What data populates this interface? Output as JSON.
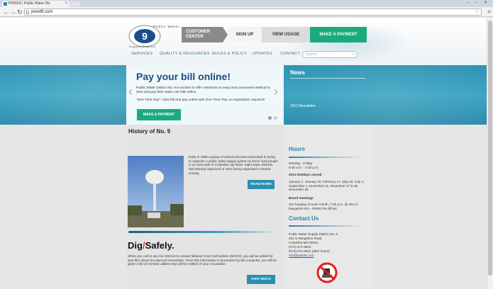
{
  "browser": {
    "tab_title": "PWSD9 | Public Water Dis",
    "tab_close": "×",
    "url": "pwsd9.com"
  },
  "header": {
    "logo": {
      "top_text": "Public Water",
      "number": "9",
      "bottom_text": "Supply District"
    },
    "customer_center": "CUSTOMER CENTER",
    "sign_up": "SIGN UP",
    "view_usage": "VIEW USAGE",
    "make_payment": "MAKE A PAYMENT"
  },
  "nav": {
    "items": [
      "SERVICES",
      "QUALITY & RESOURCES",
      "RULES & POLICY",
      "UPDATES",
      "CONTACT"
    ],
    "search_placeholder": "Search"
  },
  "slider": {
    "title": "Pay your bill online!",
    "text1": "Public Water District No. 9 is excited to offer residents an easy and convenient method to view and pay their water use bills online.",
    "text2": "\"One Time Pay\": View bill and pay online with One Time Pay, no registration required!",
    "button": "MAKE A PAYMENT"
  },
  "news": {
    "title": "News",
    "item": "2013 Newsletter"
  },
  "history": {
    "title": "History of No. 9",
    "text": "Early in 1965 a group of citizens became interested in trying to organize a public water supply system to serve rural people in an area east of Columbia city limits. Eight water districts had already organized or were being organized in Boone County.",
    "read_more": "READ MORE"
  },
  "digsafely": {
    "logo_left": "Dig",
    "logo_slash": "/",
    "logo_right": "Safely.",
    "text": "When you call or use the internet to contact Missouri One Call System (MOCS), you will be asked for specifics about the planned excavation. Once this information is processed by the computer, you will be given a list of member utilities that will be notified of your excavation.",
    "visit": "VISIT MOCS"
  },
  "hours": {
    "title": "Hours",
    "days": "Monday - Friday",
    "time": "8:00 a.m. - 4:30 p.m.",
    "holidays_label": "2014 Holidays closed",
    "holidays": "January 1, January 20, February 17, May 26, July 4, September 1, November 11, November 27 & 28, December 25",
    "board_label": "Board meetings",
    "board": "3rd Tuesday of each month, 7:30 p.m. @ 351 N Rangeline Rd – PWSD #9 offices"
  },
  "contact": {
    "title": "Contact Us",
    "line1": "Public Water Supply District No. 9",
    "line2": "351 N Rangeline Road",
    "line3": "Columbia MO 65201",
    "line4": "(573) 474-9521",
    "line5": "(573) 474-9622 (after hours)",
    "email": "info@pwsd9.com"
  },
  "colors": {
    "accent_green": "#1aaa7e",
    "accent_blue": "#2b8fb3",
    "banner": "#3ea6c4"
  }
}
